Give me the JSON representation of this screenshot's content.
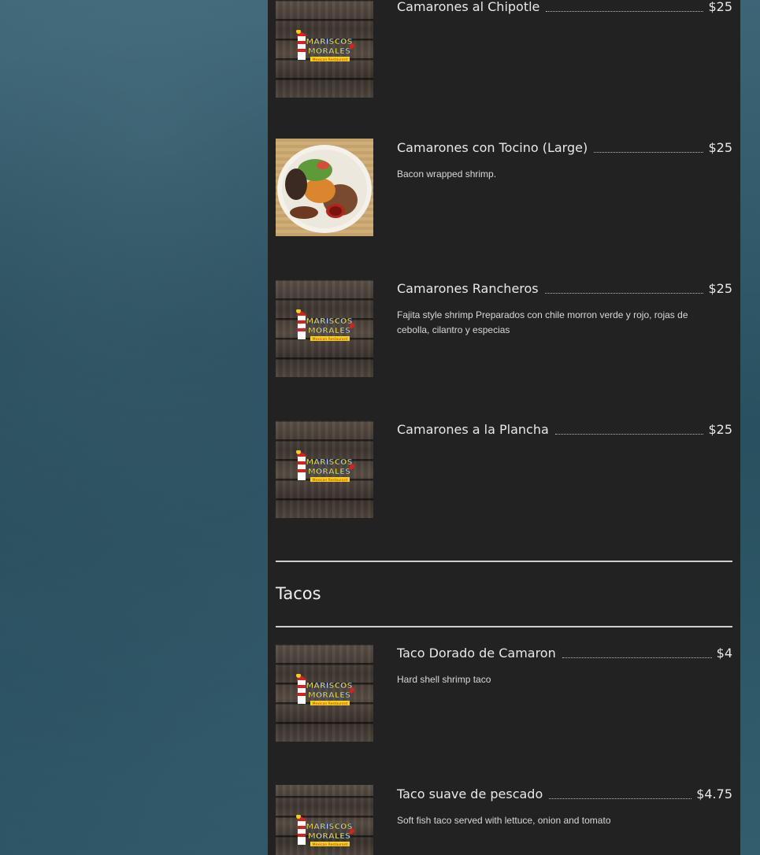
{
  "sections": [
    {
      "items": [
        {
          "name": "Camarones al Chipotle",
          "price": "$25",
          "description": "",
          "image": "logo"
        },
        {
          "name": "Camarones con Tocino (Large)",
          "price": "$25",
          "description": "Bacon wrapped shrimp.",
          "image": "food"
        },
        {
          "name": "Camarones Rancheros",
          "price": "$25",
          "description": "Fajita style shrimp Preparados con chile morron verde y rojo, rojas de cebolla, cilantro y especias",
          "image": "logo"
        },
        {
          "name": "Camarones a la Plancha",
          "price": "$25",
          "description": "",
          "image": "logo"
        }
      ]
    },
    {
      "title": "Tacos",
      "items": [
        {
          "name": "Taco Dorado de Camaron",
          "price": "$4",
          "description": "Hard shell shrimp taco",
          "image": "logo"
        },
        {
          "name": "Taco suave de pescado",
          "price": "$4.75",
          "description": "Soft fish taco served with lettuce, onion and tomato",
          "image": "logo"
        }
      ]
    }
  ],
  "logo": {
    "line1": "MARISCOS",
    "line2": "MORALES",
    "line3": "Mexican Restaurant"
  },
  "colors": {
    "panel": "#222222",
    "text": "#e8e8e8",
    "logo_yellow": "#f2d21b",
    "logo_blue": "#1e3f9c",
    "logo_red": "#d4231f"
  }
}
